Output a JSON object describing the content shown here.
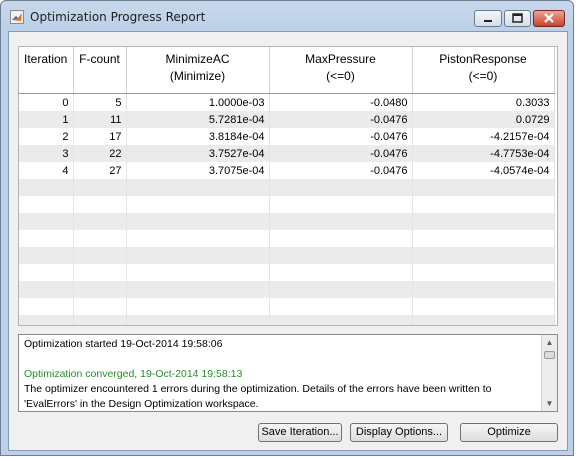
{
  "window": {
    "title": "Optimization Progress Report"
  },
  "titlebar": {
    "minimize_icon": "minimize-icon",
    "maximize_icon": "maximize-icon",
    "close_icon": "close-icon"
  },
  "table": {
    "headers": [
      {
        "line1": "Iteration",
        "line2": ""
      },
      {
        "line1": "F-count",
        "line2": ""
      },
      {
        "line1": "MinimizeAC",
        "line2": "(Minimize)"
      },
      {
        "line1": "MaxPressure",
        "line2": "(<=0)"
      },
      {
        "line1": "PistonResponse",
        "line2": "(<=0)"
      }
    ],
    "rows": [
      [
        "0",
        "5",
        "1.0000e-03",
        "-0.0480",
        "0.3033"
      ],
      [
        "1",
        "11",
        "5.7281e-04",
        "-0.0476",
        "0.0729"
      ],
      [
        "2",
        "17",
        "3.8184e-04",
        "-0.0476",
        "-4.2157e-04"
      ],
      [
        "3",
        "22",
        "3.7527e-04",
        "-0.0476",
        "-4.7753e-04"
      ],
      [
        "4",
        "27",
        "3.7075e-04",
        "-0.0476",
        "-4.0574e-04"
      ]
    ]
  },
  "log": {
    "lines": [
      {
        "text": "Optimization started 19-Oct-2014 19:58:06",
        "kind": "normal"
      },
      {
        "text": "",
        "kind": "normal"
      },
      {
        "text": "Optimization converged, 19-Oct-2014 19:58:13",
        "kind": "success"
      },
      {
        "text": "The optimizer encountered 1 errors during the optimization. Details of the errors have been written to",
        "kind": "normal"
      },
      {
        "text": "'EvalErrors' in the Design Optimization workspace.",
        "kind": "normal"
      }
    ]
  },
  "buttons": {
    "save_iteration": "Save Iteration...",
    "display_options": "Display Options...",
    "optimize": "Optimize"
  },
  "colors": {
    "success_text": "#2c8a2c",
    "window_frame": "#bcd0e8"
  }
}
